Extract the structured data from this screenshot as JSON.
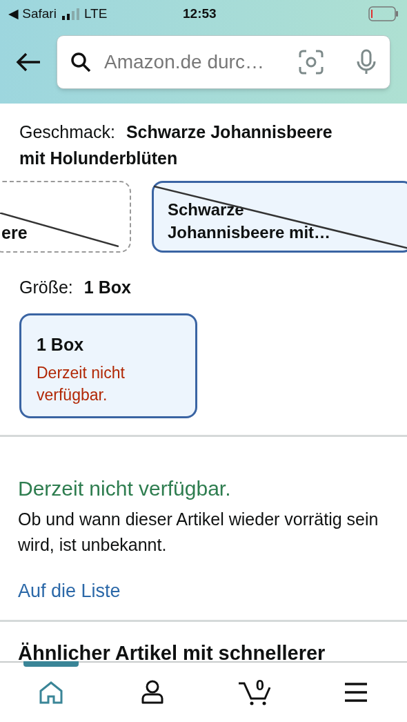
{
  "status_bar": {
    "back_app": "◀ Safari",
    "carrier": "LTE",
    "time": "12:53"
  },
  "search": {
    "placeholder": "Amazon.de durc…"
  },
  "flavor": {
    "label": "Geschmack:",
    "value": "Schwarze Johannisbeere mit Holunderblüten"
  },
  "flavor_options": [
    {
      "label": "ere",
      "selected": false,
      "available": false
    },
    {
      "label": "Schwarze Johannisbeere mit…",
      "selected": true,
      "available": false
    }
  ],
  "size": {
    "label": "Größe:",
    "value": "1 Box"
  },
  "size_options": [
    {
      "label": "1 Box",
      "note": "Derzeit nicht verfügbar.",
      "selected": true
    }
  ],
  "availability": {
    "status": "Derzeit nicht verfügbar.",
    "message": "Ob und wann dieser Artikel wieder vorrätig sein wird, ist unbekannt.",
    "link": "Auf die Liste"
  },
  "similar": {
    "heading": "Ähnlicher Artikel mit schnellerer"
  },
  "bottom_nav": [
    {
      "kind": "home",
      "selected": true
    },
    {
      "kind": "account",
      "selected": false
    },
    {
      "kind": "cart",
      "count": "0",
      "selected": false
    },
    {
      "kind": "menu",
      "selected": false
    }
  ]
}
